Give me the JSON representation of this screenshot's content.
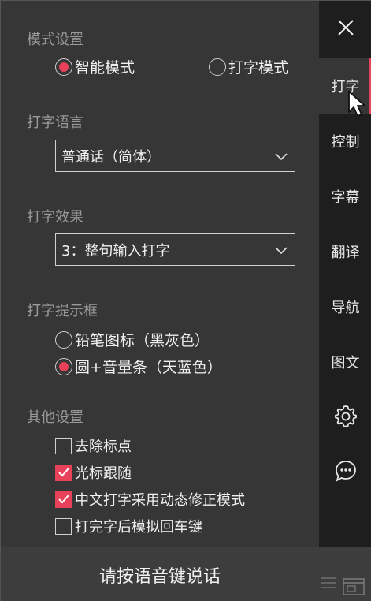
{
  "sidebar": {
    "close_icon": "close-icon",
    "tabs": [
      {
        "label": "打字",
        "active": true
      },
      {
        "label": "控制"
      },
      {
        "label": "字幕"
      },
      {
        "label": "翻译"
      },
      {
        "label": "导航"
      },
      {
        "label": "图文"
      }
    ],
    "icons": [
      "gear-icon",
      "chat-bubble-icon"
    ]
  },
  "mode": {
    "title": "模式设置",
    "options": [
      {
        "label": "智能模式",
        "selected": true
      },
      {
        "label": "打字模式",
        "selected": false
      }
    ]
  },
  "language": {
    "title": "打字语言",
    "selected": "普通话（简体）"
  },
  "effect": {
    "title": "打字效果",
    "selected": "3：整句输入打字"
  },
  "prompt_box": {
    "title": "打字提示框",
    "options": [
      {
        "label": "铅笔图标（黑灰色）",
        "selected": false
      },
      {
        "label": "圆+音量条（天蓝色）",
        "selected": true
      }
    ]
  },
  "other": {
    "title": "其他设置",
    "options": [
      {
        "label": "去除标点",
        "checked": false
      },
      {
        "label": "光标跟随",
        "checked": true
      },
      {
        "label": "中文打字采用动态修正模式",
        "checked": true
      },
      {
        "label": "打完字后模拟回车键",
        "checked": false
      }
    ]
  },
  "bottom": {
    "talk_label": "请按语音键说话"
  },
  "colors": {
    "accent": "#e8415a",
    "panel": "#363636",
    "sidebar": "#1e1e1e"
  }
}
